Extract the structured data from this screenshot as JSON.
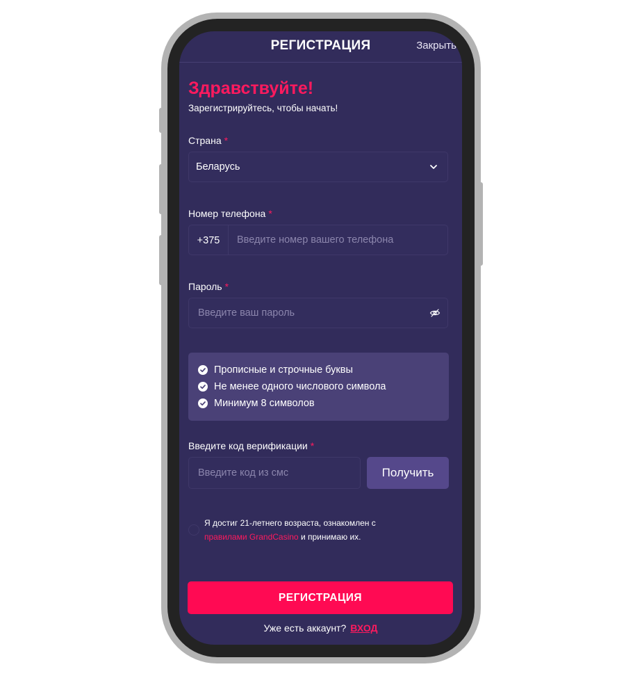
{
  "header": {
    "title": "РЕГИСТРАЦИЯ",
    "close_label": "Закрыть"
  },
  "greeting": {
    "title": "Здравствуйте!",
    "subtitle": "Зарегистрируйтесь, чтобы начать!"
  },
  "form": {
    "country": {
      "label": "Страна",
      "required_mark": "*",
      "value": "Беларусь",
      "icon": "chevron-down-icon"
    },
    "phone": {
      "label": "Номер телефона",
      "required_mark": "*",
      "prefix": "+375",
      "placeholder": "Введите номер вашего телефона"
    },
    "password": {
      "label": "Пароль",
      "required_mark": "*",
      "placeholder": "Введите ваш пароль",
      "icon": "eye-off-icon"
    },
    "password_rules": [
      "Прописные и строчные буквы",
      "Не менее одного числового символа",
      "Минимум 8 символов"
    ],
    "verification": {
      "label": "Введите код верификации",
      "required_mark": "*",
      "placeholder": "Введите код из смс",
      "button_label": "Получить"
    },
    "agreement": {
      "text_before": "Я достиг 21-летнего возраста, ознакомлен с",
      "link_text": "правилами GrandCasino",
      "text_after": "и принимаю их."
    },
    "submit_label": "РЕГИСТРАЦИЯ"
  },
  "footer": {
    "question": "Уже есть аккаунт?",
    "login_label": "ВХОД"
  },
  "colors": {
    "accent": "#ff0a53",
    "background": "#322c5b",
    "rules_box": "#4a4177",
    "secondary_button": "#55488b"
  }
}
